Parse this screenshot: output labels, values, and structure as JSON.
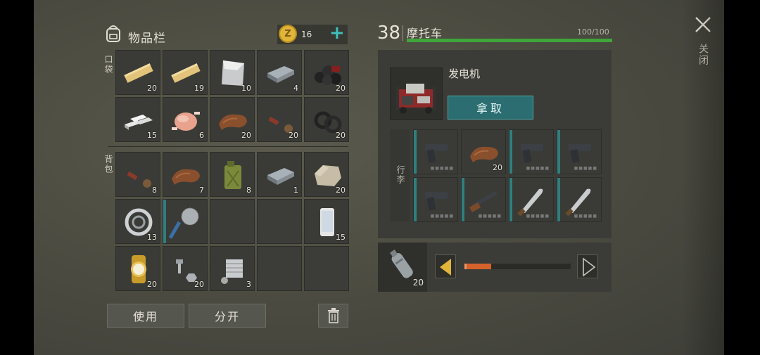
{
  "left": {
    "title": "物品栏",
    "coins": "16",
    "add_symbol": "+",
    "pocket_label": "口袋",
    "backpack_label": "背包",
    "pocket": [
      {
        "icon": "wood-plank-icon",
        "count": "20"
      },
      {
        "icon": "wood-plank-icon",
        "count": "19"
      },
      {
        "icon": "steel-sheet-icon",
        "count": "10"
      },
      {
        "icon": "iron-bar-icon",
        "count": "4"
      },
      {
        "icon": "coal-icon",
        "count": "20"
      },
      {
        "icon": "aluminum-bars-icon",
        "count": "15"
      },
      {
        "icon": "raw-chicken-icon",
        "count": "6"
      },
      {
        "icon": "leather-icon",
        "count": "20"
      },
      {
        "icon": "weapon-parts-icon",
        "count": "20"
      },
      {
        "icon": "rubber-rings-icon",
        "count": "20"
      }
    ],
    "backpack": [
      {
        "icon": "weapon-parts-icon",
        "count": "8"
      },
      {
        "icon": "leather-icon",
        "count": "7"
      },
      {
        "icon": "jerrycan-icon",
        "count": "8"
      },
      {
        "icon": "iron-bar-icon",
        "count": "1"
      },
      {
        "icon": "stone-icon",
        "count": "20"
      },
      {
        "icon": "bearing-icon",
        "count": "13"
      },
      {
        "icon": "saw-blade-icon",
        "count": ""
      },
      {
        "icon": "",
        "count": ""
      },
      {
        "icon": "",
        "count": ""
      },
      {
        "icon": "smartphone-icon",
        "count": "15"
      },
      {
        "icon": "gold-watch-icon",
        "count": "20"
      },
      {
        "icon": "bolts-icon",
        "count": "20"
      },
      {
        "icon": "engine-part-icon",
        "count": "3"
      },
      {
        "icon": "",
        "count": ""
      },
      {
        "icon": "",
        "count": ""
      }
    ],
    "use_label": "使用",
    "split_label": "分开"
  },
  "right": {
    "level": "38",
    "vehicle_name": "摩托车",
    "health": "100/100",
    "health_fraction": 1.0,
    "generator_name": "发电机",
    "take_label": "拿取",
    "luggage_label": "行李",
    "luggage": [
      {
        "icon": "pistol-icon",
        "count": ""
      },
      {
        "icon": "leather-icon",
        "count": "20"
      },
      {
        "icon": "pistol-icon",
        "count": ""
      },
      {
        "icon": "pistol-icon",
        "count": ""
      },
      {
        "icon": "pistol-icon",
        "count": ""
      },
      {
        "icon": "shotgun-icon",
        "count": ""
      },
      {
        "icon": "machete-icon",
        "count": ""
      },
      {
        "icon": "machete-icon",
        "count": ""
      }
    ],
    "fuel_count": "20",
    "fuel_fraction": 0.25
  },
  "close_label": "关闭",
  "colors": {
    "accent_teal": "#2f7f7f",
    "health_green": "#3ea63a",
    "fuel_orange": "#d4622a",
    "coin_gold": "#e1b43a"
  }
}
